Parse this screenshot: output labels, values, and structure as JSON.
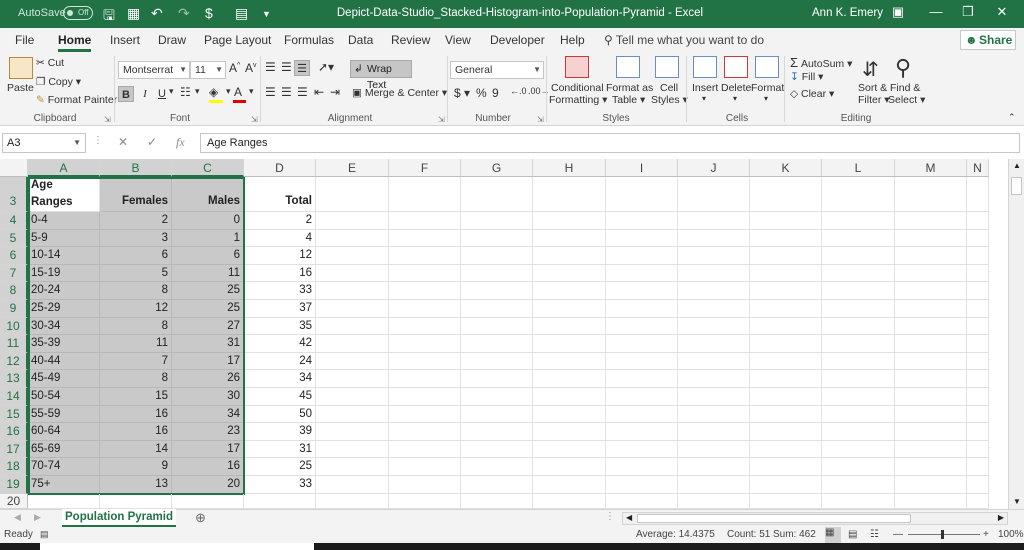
{
  "titlebar": {
    "autosave_label": "AutoSave",
    "autosave_state": "Off",
    "document_title": "Depict-Data-Studio_Stacked-Histogram-into-Population-Pyramid  -  Excel",
    "user_name": "Ann K. Emery",
    "accent_color": "#217346"
  },
  "tabs": [
    "File",
    "Home",
    "Insert",
    "Draw",
    "Page Layout",
    "Formulas",
    "Data",
    "Review",
    "View",
    "Developer",
    "Help"
  ],
  "active_tab": "Home",
  "tell_me": "Tell me what you want to do",
  "share_label": "Share",
  "ribbon": {
    "clipboard": {
      "paste": "Paste",
      "cut": "Cut",
      "copy": "Copy",
      "format_painter": "Format Painter",
      "label": "Clipboard"
    },
    "font": {
      "name": "Montserrat",
      "size": "11",
      "label": "Font",
      "bold": "B",
      "italic": "I",
      "underline": "U"
    },
    "alignment": {
      "wrap_text": "Wrap Text",
      "merge_center": "Merge & Center",
      "label": "Alignment"
    },
    "number": {
      "format": "General",
      "label": "Number"
    },
    "styles": {
      "conditional1": "Conditional",
      "conditional2": "Formatting",
      "format_as1": "Format as",
      "format_as2": "Table",
      "cell_styles1": "Cell",
      "cell_styles2": "Styles",
      "label": "Styles"
    },
    "cells": {
      "insert": "Insert",
      "delete": "Delete",
      "format": "Format",
      "label": "Cells"
    },
    "editing": {
      "autosum": "AutoSum",
      "fill": "Fill",
      "clear": "Clear",
      "sort1": "Sort &",
      "sort2": "Filter",
      "find1": "Find &",
      "find2": "Select",
      "label": "Editing"
    }
  },
  "formula_bar": {
    "name_box": "A3",
    "fx": "fx",
    "content": "Age Ranges"
  },
  "columns": [
    "A",
    "B",
    "C",
    "D",
    "E",
    "F",
    "G",
    "H",
    "I",
    "J",
    "K",
    "L",
    "M",
    "N"
  ],
  "selected_columns": [
    "A",
    "B",
    "C"
  ],
  "header_row": {
    "row": "3",
    "a1": "Age",
    "a2": "Ranges",
    "b": "Females",
    "c": "Males",
    "d": "Total"
  },
  "rows": [
    {
      "row": "4",
      "age": "0-4",
      "females": "2",
      "males": "0",
      "total": "2"
    },
    {
      "row": "5",
      "age": "5-9",
      "females": "3",
      "males": "1",
      "total": "4"
    },
    {
      "row": "6",
      "age": "10-14",
      "females": "6",
      "males": "6",
      "total": "12"
    },
    {
      "row": "7",
      "age": "15-19",
      "females": "5",
      "males": "11",
      "total": "16"
    },
    {
      "row": "8",
      "age": "20-24",
      "females": "8",
      "males": "25",
      "total": "33"
    },
    {
      "row": "9",
      "age": "25-29",
      "females": "12",
      "males": "25",
      "total": "37"
    },
    {
      "row": "10",
      "age": "30-34",
      "females": "8",
      "males": "27",
      "total": "35"
    },
    {
      "row": "11",
      "age": "35-39",
      "females": "11",
      "males": "31",
      "total": "42"
    },
    {
      "row": "12",
      "age": "40-44",
      "females": "7",
      "males": "17",
      "total": "24"
    },
    {
      "row": "13",
      "age": "45-49",
      "females": "8",
      "males": "26",
      "total": "34"
    },
    {
      "row": "14",
      "age": "50-54",
      "females": "15",
      "males": "30",
      "total": "45"
    },
    {
      "row": "15",
      "age": "55-59",
      "females": "16",
      "males": "34",
      "total": "50"
    },
    {
      "row": "16",
      "age": "60-64",
      "females": "16",
      "males": "23",
      "total": "39"
    },
    {
      "row": "17",
      "age": "65-69",
      "females": "14",
      "males": "17",
      "total": "31"
    },
    {
      "row": "18",
      "age": "70-74",
      "females": "9",
      "males": "16",
      "total": "25"
    },
    {
      "row": "19",
      "age": "75+",
      "females": "13",
      "males": "20",
      "total": "33"
    }
  ],
  "extra_row": "20",
  "sheet_tab": "Population Pyramid",
  "status": {
    "ready": "Ready",
    "average": "Average: 14.4375",
    "count": "Count: 51",
    "sum": "Sum: 462",
    "zoom": "100%"
  }
}
